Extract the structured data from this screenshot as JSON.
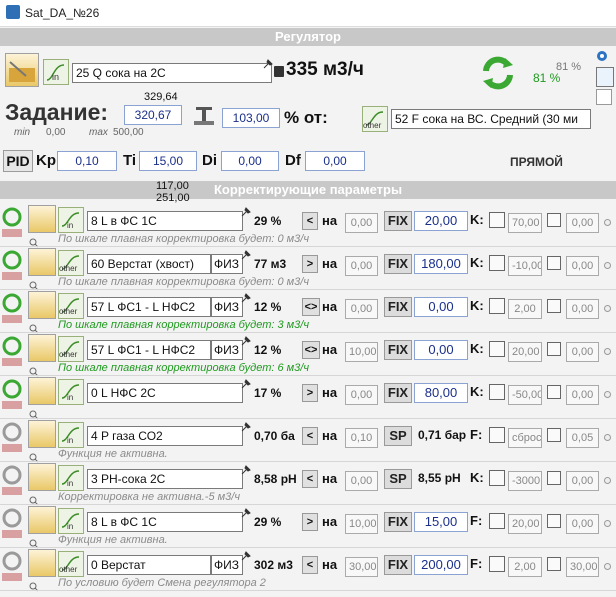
{
  "window": {
    "title": "Sat_DA_№26"
  },
  "regulator": {
    "section_title": "Регулятор",
    "input_channel": "25 Q сока на 2С",
    "input_type": "in",
    "current_value": "335 м3/ч",
    "percent": "81 %",
    "percent_small": "81 %",
    "task_label": "Задание:",
    "task_value": "320,67",
    "task_top": "329,64",
    "min_label": "min",
    "min_value": "0,00",
    "max_label": "max",
    "max_value": "500,00",
    "ratio_value": "103,00",
    "ratio_suffix": "% от:",
    "source_type": "other",
    "source_channel": "52 F сока на ВС. Средний (30 ми",
    "pid_label": "PID",
    "kp_label": "Kp",
    "kp_value": "0,10",
    "ti_label": "Ti",
    "ti_value": "15,00",
    "di_label": "Di",
    "di_value": "0,00",
    "df_label": "Df",
    "df_value": "0,00",
    "direction": "ПРЯМОЙ",
    "corr_top1": "117,00",
    "corr_top2": "251,00"
  },
  "correction": {
    "section_title": "Корректирующие параметры",
    "rows": [
      {
        "type": "in",
        "channel": "8 L в ФС 1С",
        "phys": "",
        "value": "29 %",
        "arrow": "<",
        "na": "на",
        "na_val": "0,00",
        "mode": "FIX",
        "set": "20,00",
        "k": "K:",
        "k_val": "70,00",
        "tail": "0,00",
        "note": "По шкале плавная корректировка будет: 0 м3/ч",
        "note_color": "gray"
      },
      {
        "type": "other",
        "channel": "60 Верстат (хвост)",
        "phys": "ФИЗ",
        "value": "77 м3",
        "arrow": ">",
        "na": "на",
        "na_val": "0,00",
        "mode": "FIX",
        "set": "180,00",
        "k": "K:",
        "k_val": "-10,00",
        "tail": "0,00",
        "note": "По шкале плавная корректировка будет: 0 м3/ч",
        "note_color": "gray"
      },
      {
        "type": "other",
        "channel": "57 L ФС1 - L НФС2",
        "phys": "ФИЗ",
        "value": "12 %",
        "arrow": "<>",
        "na": "на",
        "na_val": "0,00",
        "mode": "FIX",
        "set": "0,00",
        "k": "K:",
        "k_val": "2,00",
        "tail": "0,00",
        "note": "По шкале плавная корректировка будет: 3 м3/ч",
        "note_color": "green"
      },
      {
        "type": "other",
        "channel": "57 L ФС1 - L НФС2",
        "phys": "ФИЗ",
        "value": "12 %",
        "arrow": "<>",
        "na": "на",
        "na_val": "10,00",
        "mode": "FIX",
        "set": "0,00",
        "k": "K:",
        "k_val": "20,00",
        "tail": "0,00",
        "note": "По шкале плавная корректировка будет: 6 м3/ч",
        "note_color": "green"
      },
      {
        "type": "in",
        "channel": "0 L НФС 2С",
        "phys": "",
        "value": "17 %",
        "arrow": ">",
        "na": "на",
        "na_val": "0,00",
        "mode": "FIX",
        "set": "80,00",
        "k": "K:",
        "k_val": "-50,00",
        "tail": "0,00",
        "note": "",
        "note_color": "gray"
      },
      {
        "type": "in",
        "channel": "4 P газа СО2",
        "phys": "",
        "value": "0,70 ба",
        "arrow": "<",
        "na": "на",
        "na_val": "0,10",
        "mode": "SP",
        "set": "0,71 бар",
        "k": "F:",
        "k_val": "сброс",
        "tail": "0,05",
        "note": "Функция не активна.",
        "note_color": "gray"
      },
      {
        "type": "in",
        "channel": "3 PH-сока 2С",
        "phys": "",
        "value": "8,58 рН",
        "arrow": "<",
        "na": "на",
        "na_val": "0,00",
        "mode": "SP",
        "set": "8,55 рН",
        "k": "K:",
        "k_val": "-3000,0",
        "tail": "0,00",
        "note": "Корректировка не активна.-5 м3/ч",
        "note_color": "gray"
      },
      {
        "type": "in",
        "channel": "8 L в ФС 1С",
        "phys": "",
        "value": "29 %",
        "arrow": ">",
        "na": "на",
        "na_val": "10,00",
        "mode": "FIX",
        "set": "15,00",
        "k": "F:",
        "k_val": "20,00",
        "tail": "0,00",
        "note": "Функция не активна.",
        "note_color": "gray"
      },
      {
        "type": "other",
        "channel": "0 Верстат",
        "phys": "ФИЗ",
        "value": "302 м3",
        "arrow": "<",
        "na": "на",
        "na_val": "30,00",
        "mode": "FIX",
        "set": "200,00",
        "k": "F:",
        "k_val": "2,00",
        "tail": "30,00",
        "note": "По условию будет Смена регулятора 2",
        "note_color": "gray"
      }
    ]
  }
}
